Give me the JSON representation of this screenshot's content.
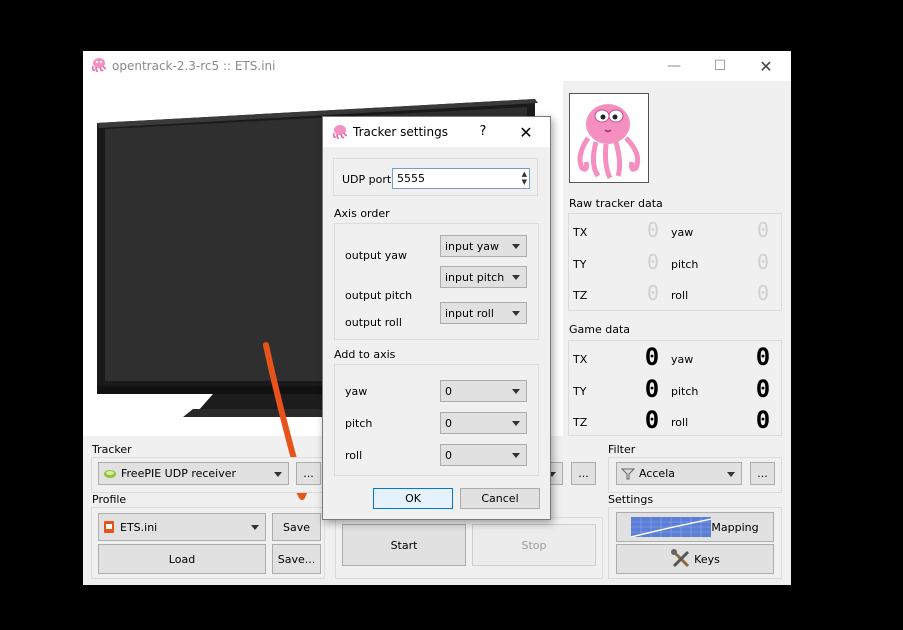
{
  "window": {
    "title": "opentrack-2.3-rc5 :: ETS.ini",
    "minimize": "—",
    "maximize": "☐",
    "close": "✕"
  },
  "raw_tracker": {
    "title": "Raw tracker data",
    "labels": {
      "tx": "TX",
      "ty": "TY",
      "tz": "TZ",
      "yaw": "yaw",
      "pitch": "pitch",
      "roll": "roll"
    },
    "digit": "0"
  },
  "game_data": {
    "title": "Game data",
    "labels": {
      "tx": "TX",
      "ty": "TY",
      "tz": "TZ",
      "yaw": "yaw",
      "pitch": "pitch",
      "roll": "roll"
    },
    "digit": "0"
  },
  "tracker": {
    "title": "Tracker",
    "selected": "FreePIE UDP receiver",
    "settings_button": "..."
  },
  "protocol": {
    "settings_button": "..."
  },
  "filter": {
    "title": "Filter",
    "selected": "Accela",
    "settings_button": "..."
  },
  "profile": {
    "title": "Profile",
    "selected": "ETS.ini",
    "save": "Save",
    "load": "Load",
    "save_as": "Save..."
  },
  "controls": {
    "start": "Start",
    "stop": "Stop"
  },
  "settings": {
    "title": "Settings",
    "mapping": "Mapping",
    "keys": "Keys"
  },
  "dialog": {
    "title": "Tracker settings",
    "help": "?",
    "close": "✕",
    "udp_label": "UDP port",
    "udp_value": "5555",
    "axis_order_title": "Axis order",
    "output_yaw": "output yaw",
    "output_pitch": "output pitch",
    "output_roll": "output roll",
    "combo_yaw": "input yaw",
    "combo_pitch": "input pitch",
    "combo_roll": "input roll",
    "add_to_axis_title": "Add to axis",
    "yaw": "yaw",
    "pitch": "pitch",
    "roll": "roll",
    "add_yaw": "0",
    "add_pitch": "0",
    "add_roll": "0",
    "ok": "OK",
    "cancel": "Cancel"
  },
  "colors": {
    "arrow": "#e8531b",
    "octopus": "#f58fc0",
    "accent": "#0078d7"
  }
}
